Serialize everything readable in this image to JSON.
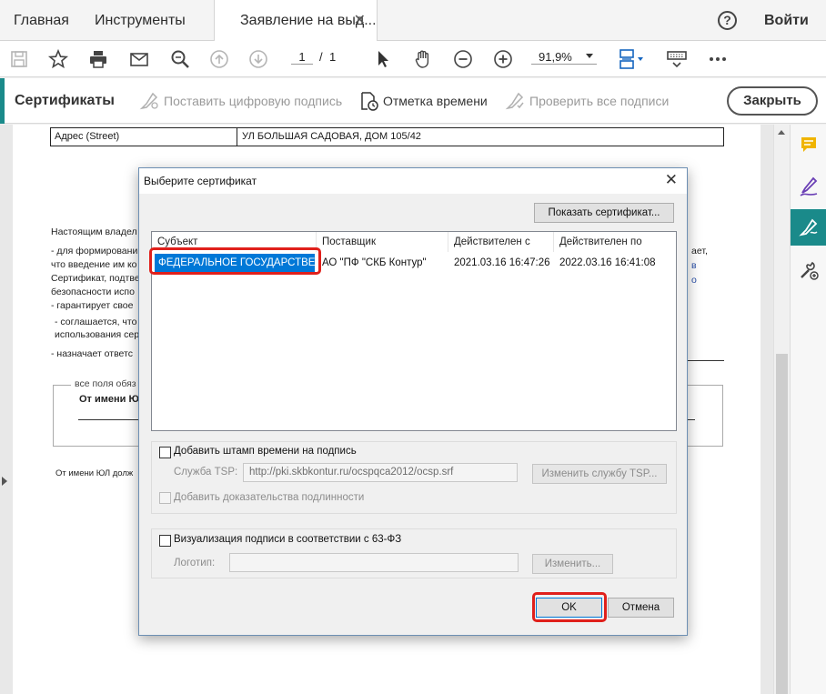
{
  "tabs": {
    "home": "Главная",
    "tools": "Инструменты",
    "document": "Заявление на выд...",
    "help": "?",
    "login": "Войти"
  },
  "toolbar": {
    "page_current": "1",
    "page_separator": "/",
    "page_total": "1",
    "zoom": "91,9%"
  },
  "certbar": {
    "title": "Сертификаты",
    "sign": "Поставить цифровую подпись",
    "timestamp": "Отметка времени",
    "verify": "Проверить все подписи",
    "close": "Закрыть"
  },
  "document": {
    "address_label": "Адрес (Street)",
    "address_value": "УЛ БОЛЬШАЯ САДОВАЯ, ДОМ 105/42",
    "lines": [
      "Настоящим владел",
      "- для формировани",
      "что введение им ко",
      "Сертификат, подтве",
      "безопасности испо",
      "- гарантирует свое",
      "- соглашается, что",
      "использования сер",
      "- назначает ответс"
    ],
    "right_fragments": [
      "ает,",
      "в",
      "о"
    ],
    "fieldset_legend": "все поля обяз",
    "fieldset_text": "От имени Ю",
    "footer_text": "От имени ЮЛ долж"
  },
  "dialog": {
    "title": "Выберите сертификат",
    "show_cert": "Показать сертификат...",
    "columns": [
      "Субъект",
      "Поставщик",
      "Действителен с",
      "Действителен по"
    ],
    "rows": [
      {
        "subject": "ФЕДЕРАЛЬНОЕ ГОСУДАРСТВЕН...",
        "issuer": "АО \"ПФ \"СКБ Контур\"",
        "valid_from": "2021.03.16 16:47:26",
        "valid_to": "2022.03.16 16:41:08"
      }
    ],
    "add_timestamp": "Добавить штамп времени на подпись",
    "tsp_label": "Служба TSP:",
    "tsp_value": "http://pki.skbkontur.ru/ocspqca2012/ocsp.srf",
    "change_tsp": "Изменить службу TSP...",
    "add_evidence": "Добавить доказательства подлинности",
    "visualize": "Визуализация подписи в соответствии с 63-ФЗ",
    "logo_label": "Логотип:",
    "change": "Изменить...",
    "ok": "OK",
    "cancel": "Отмена"
  },
  "colors": {
    "accent": "#1a8a8a",
    "selection": "#0078d7",
    "highlight": "#e0201b"
  }
}
